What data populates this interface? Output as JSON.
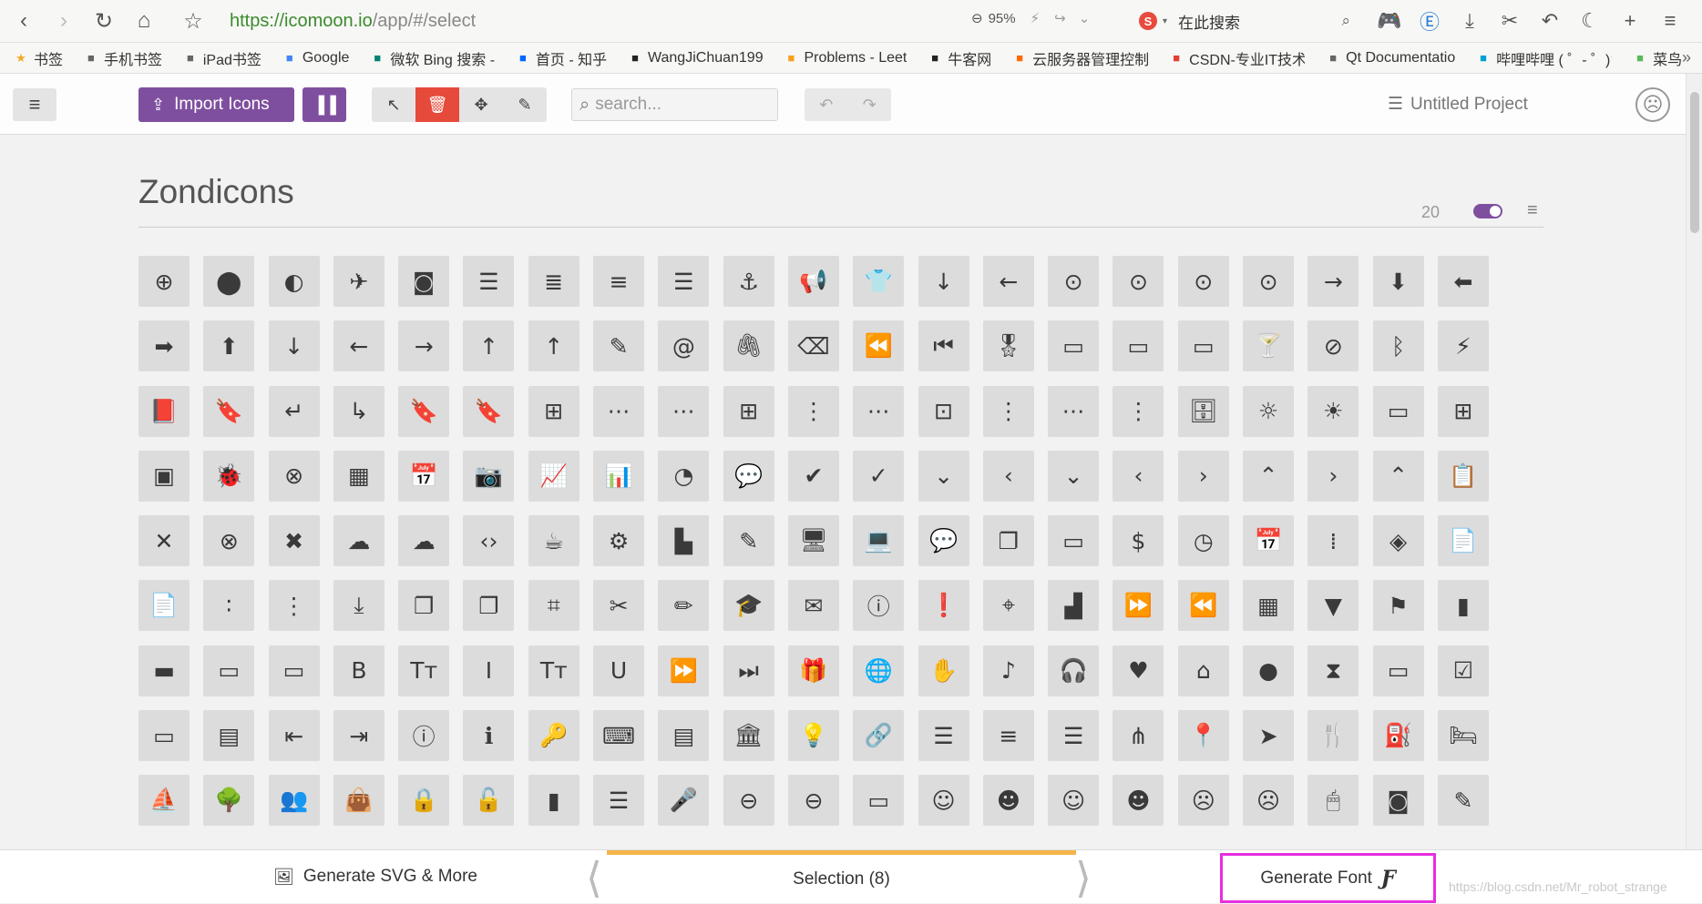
{
  "browser": {
    "url_scheme": "https://",
    "url_host": "icomoon.io",
    "url_path": "/app/#/select",
    "zoom": "95%",
    "search_placeholder": "在此搜索",
    "bookmarks": [
      {
        "label": "书签",
        "icon": "star-icon",
        "color": "#f5a623"
      },
      {
        "label": "手机书签",
        "icon": "phone-icon",
        "color": "#666666"
      },
      {
        "label": "iPad书签",
        "icon": "tablet-icon",
        "color": "#666666"
      },
      {
        "label": "Google",
        "icon": "google-icon",
        "color": "#4285f4"
      },
      {
        "label": "微软 Bing 搜索 -",
        "icon": "bing-icon",
        "color": "#008373"
      },
      {
        "label": "首页 - 知乎",
        "icon": "zhihu-icon",
        "color": "#0066ff"
      },
      {
        "label": "WangJiChuan199",
        "icon": "github-icon",
        "color": "#222222"
      },
      {
        "label": "Problems - Leet",
        "icon": "leetcode-icon",
        "color": "#f89f1b"
      },
      {
        "label": "牛客网",
        "icon": "nowcoder-icon",
        "color": "#222222"
      },
      {
        "label": "云服务器管理控制",
        "icon": "aliyun-icon",
        "color": "#ff6a00"
      },
      {
        "label": "CSDN-专业IT技术",
        "icon": "csdn-icon",
        "color": "#e33e33"
      },
      {
        "label": "Qt Documentatio",
        "icon": "globe-icon",
        "color": "#666666"
      },
      {
        "label": "哔哩哔哩 ( ゜- ゜)つ",
        "icon": "bilibili-icon",
        "color": "#00a1d6"
      },
      {
        "label": "菜鸟",
        "icon": "runoob-icon",
        "color": "#5cb85c"
      }
    ]
  },
  "toolbar": {
    "import_label": "Import Icons",
    "search_placeholder": "search...",
    "project_title": "Untitled Project"
  },
  "icon_set": {
    "title": "Zondicons",
    "count": "20",
    "glyphs": [
      "⊕",
      "⬤",
      "◐",
      "✈",
      "◙",
      "☰",
      "≣",
      "≡",
      "☰",
      "⚓",
      "📢",
      "👕",
      "↓",
      "←",
      "⊙",
      "⊙",
      "⊙",
      "⊙",
      "→",
      "⬇",
      "⬅",
      "➡",
      "⬆",
      "↓",
      "←",
      "→",
      "↑",
      "↑",
      "✎",
      "@",
      "🖇",
      "⌫",
      "⏪",
      "⏮",
      "🎖",
      "▭",
      "▭",
      "▭",
      "🍸",
      "⊘",
      "ᛒ",
      "⚡",
      "📕",
      "🔖",
      "↵",
      "↳",
      "🔖",
      "🔖",
      "⊞",
      "⋯",
      "⋯",
      "⊞",
      "⋮",
      "⋯",
      "⊡",
      "⋮",
      "⋯",
      "⋮",
      "🗄",
      "☼",
      "☀",
      "▭",
      "⊞",
      "▣",
      "🐞",
      "⊗",
      "▦",
      "📅",
      "📷",
      "📈",
      "📊",
      "◔",
      "💬",
      "✔",
      "✓",
      "⌄",
      "‹",
      "⌄",
      "‹",
      "›",
      "⌃",
      "›",
      "⌃",
      "📋",
      "✕",
      "⊗",
      "✖",
      "☁",
      "☁",
      "‹›",
      "☕",
      "⚙",
      "▙",
      "✎",
      "🖥",
      "💻",
      "💬",
      "❐",
      "▭",
      "$",
      "◷",
      "📅",
      "⁞",
      "◈",
      "📄",
      "📄",
      "∶",
      "⋮",
      "⤓",
      "❐",
      "❐",
      "⌗",
      "✂",
      "✏",
      "🎓",
      "✉",
      "ⓘ",
      "❗",
      "⌖",
      "▟",
      "⏩",
      "⏪",
      "▦",
      "▼",
      "⚑",
      "▮",
      "▬",
      "▭",
      "▭",
      "B",
      "Tт",
      "I",
      "Tт",
      "U",
      "⏩",
      "⏭",
      "🎁",
      "🌐",
      "✋",
      "♪",
      "🎧",
      "♥",
      "⌂",
      "●",
      "⧗",
      "▭",
      "☑",
      "▭",
      "▤",
      "⇤",
      "⇥",
      "ⓘ",
      "ℹ",
      "🔑",
      "⌨",
      "▤",
      "🏛",
      "💡",
      "🔗",
      "☰",
      "≡",
      "☰",
      "⋔",
      "📍",
      "➤",
      "🍴",
      "⛽",
      "🛏",
      "⛵",
      "🌳",
      "👥",
      "👜",
      "🔒",
      "🔓",
      "▮",
      "☰",
      "🎤",
      "⊖",
      "⊖",
      "▭",
      "☺",
      "☻",
      "☺",
      "☻",
      "☹",
      "☹",
      "🖱",
      "◙",
      "✎"
    ]
  },
  "bottom": {
    "generate_svg_label": "Generate SVG & More",
    "selection_label": "Selection (8)",
    "generate_font_label": "Generate Font",
    "watermark": "https://blog.csdn.net/Mr_robot_strange"
  }
}
